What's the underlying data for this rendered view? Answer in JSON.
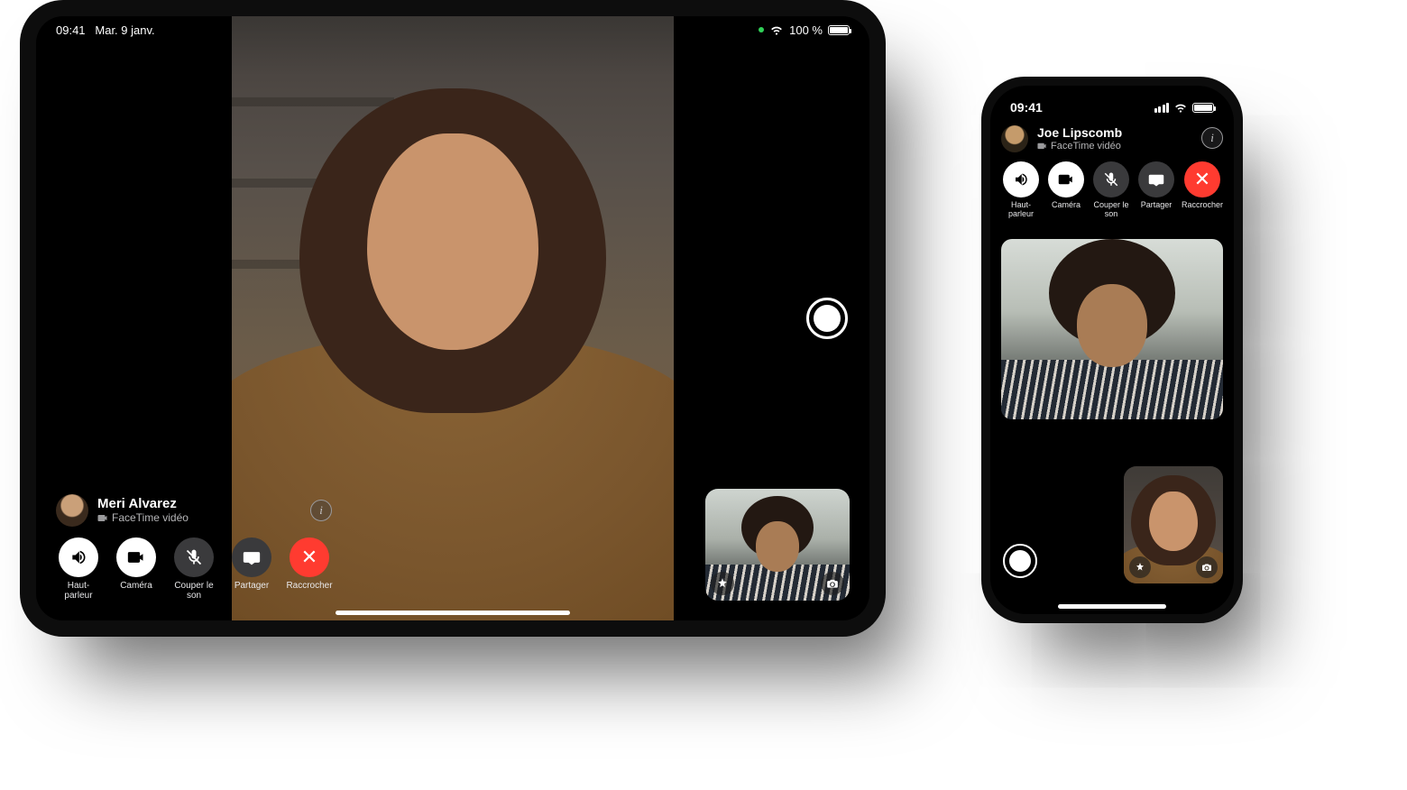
{
  "ipad": {
    "status": {
      "time": "09:41",
      "date": "Mar. 9 janv.",
      "battery_text": "100 %"
    },
    "caller": {
      "name": "Meri Alvarez",
      "subtitle": "FaceTime vidéo"
    },
    "controls": {
      "speaker": "Haut-parleur",
      "camera": "Caméra",
      "mute": "Couper le son",
      "share": "Partager",
      "end": "Raccrocher"
    }
  },
  "iphone": {
    "status": {
      "time": "09:41"
    },
    "caller": {
      "name": "Joe Lipscomb",
      "subtitle": "FaceTime vidéo"
    },
    "controls": {
      "speaker": "Haut-parleur",
      "camera": "Caméra",
      "mute": "Couper le son",
      "share": "Partager",
      "end": "Raccrocher"
    }
  },
  "colors": {
    "end_call": "#ff3b30",
    "camera_dot": "#30d158"
  }
}
